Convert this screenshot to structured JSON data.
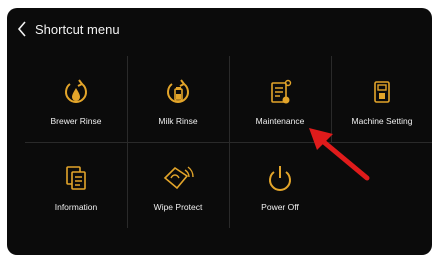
{
  "header": {
    "title": "Shortcut menu",
    "back_icon": "chevron-left-icon"
  },
  "tiles": [
    {
      "label": "Brewer Rinse",
      "icon": "brewer-rinse-icon"
    },
    {
      "label": "Milk Rinse",
      "icon": "milk-rinse-icon"
    },
    {
      "label": "Maintenance",
      "icon": "maintenance-icon"
    },
    {
      "label": "Machine Setting",
      "icon": "machine-setting-icon"
    },
    {
      "label": "Information",
      "icon": "information-icon"
    },
    {
      "label": "Wipe Protect",
      "icon": "wipe-protect-icon"
    },
    {
      "label": "Power Off",
      "icon": "power-off-icon"
    }
  ],
  "colors": {
    "icon": "#e3a52a",
    "background": "#0b0b0b",
    "text": "#f0f0f0",
    "annotation_arrow": "#e01b1b"
  }
}
